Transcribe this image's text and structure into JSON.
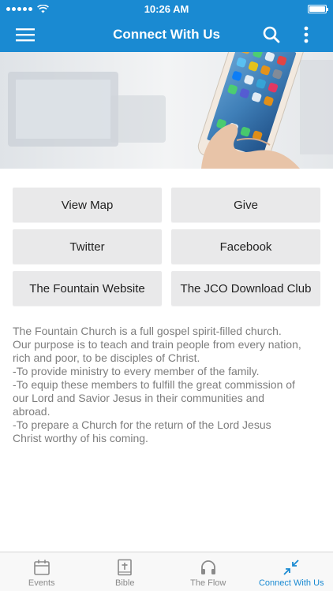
{
  "status_bar": {
    "time": "10:26 AM",
    "battery_level": 1.0
  },
  "header": {
    "title": "Connect With Us",
    "background_color": "#1a8ad2",
    "icons": [
      "menu-icon",
      "search-icon",
      "more-vertical-icon"
    ]
  },
  "links": [
    {
      "label": "View Map"
    },
    {
      "label": "Give"
    },
    {
      "label": "Twitter"
    },
    {
      "label": "Facebook"
    },
    {
      "label": "The Fountain Website"
    },
    {
      "label": "The JCO Download Club"
    }
  ],
  "description": {
    "lines": [
      "The Fountain Church is a full gospel spirit-filled church.",
      "Our purpose is to teach and train people from every nation,",
      "rich and poor, to be disciples of Christ.",
      "-To provide ministry to every member of the family.",
      "-To equip these members to fulfill the great commission of",
      "our Lord and Savior Jesus in their communities and",
      "abroad.",
      "-To prepare a Church for the return of the Lord Jesus",
      "Christ worthy of his coming."
    ]
  },
  "tab_bar": {
    "active_color": "#1a8ad2",
    "tabs": [
      {
        "label": "Events",
        "icon": "calendar-icon"
      },
      {
        "label": "Bible",
        "icon": "bible-icon"
      },
      {
        "label": "The Flow",
        "icon": "headphones-icon"
      },
      {
        "label": "Connect With Us",
        "icon": "arrows-in-icon",
        "active": true
      }
    ]
  }
}
